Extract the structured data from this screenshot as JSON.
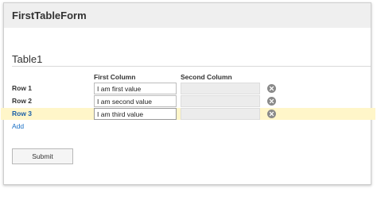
{
  "form": {
    "title": "FirstTableForm"
  },
  "table": {
    "title": "Table1",
    "columns": [
      "First Column",
      "Second Column"
    ],
    "rows": [
      {
        "label": "Row 1",
        "first_column": "I am first value",
        "second_column": ""
      },
      {
        "label": "Row 2",
        "first_column": "I am second value",
        "second_column": ""
      },
      {
        "label": "Row 3",
        "first_column": "I am third value",
        "second_column": "",
        "selected": true
      }
    ],
    "add_label": "Add"
  },
  "actions": {
    "submit_label": "Submit"
  },
  "colors": {
    "header_bg": "#efefef",
    "selected_row_bg": "#fff6c9",
    "link": "#1a6fc4",
    "disabled_cell": "#ececec"
  },
  "icons": {
    "remove_row": "circle-x-icon"
  }
}
